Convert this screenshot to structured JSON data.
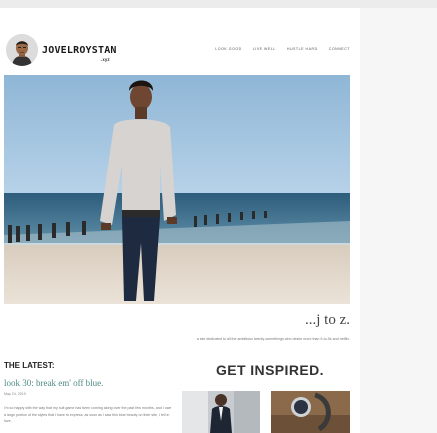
{
  "brand": {
    "name": "JOVELROYSTAN",
    "tld": ".xyz"
  },
  "nav": [
    "LOOK GOOD",
    "LIVE WELL",
    "HUSTLE HARD",
    "CONNECT"
  ],
  "hero": {
    "icon": "hero-photo"
  },
  "tagline": "...j to z.",
  "tagline_description": "a site dedicated to all the ambitious twenty-somethings who desire more than 9-to-5s and netflix.",
  "latest": {
    "heading": "THE LATEST:",
    "post_title": "look 30: break em' off blue.",
    "post_date": "May 24, 2019",
    "post_excerpt": "I'm so happy with the way that my suit game has been coming along over the past few months, and I owe a large portion of the styles that I have to express, as soon as I saw this blue beauty on their site, I fell in love."
  },
  "inspired": {
    "heading": "GET INSPIRED."
  },
  "colors": {
    "accent": "#4e8a86",
    "sky": "#a4c6e0",
    "sea": "#2f5f7e",
    "sand": "#e3d9cc"
  }
}
